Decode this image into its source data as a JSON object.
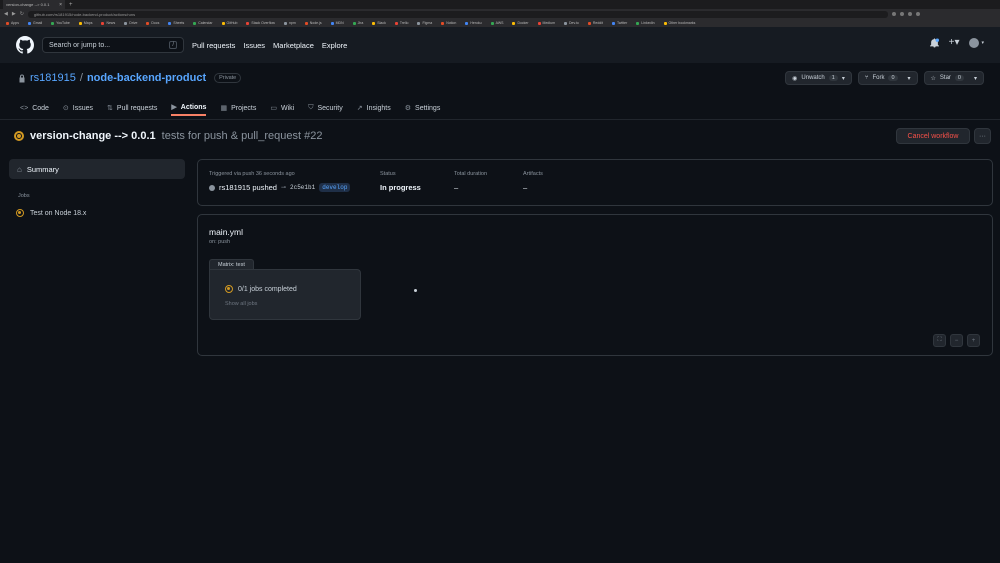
{
  "browser": {
    "tab_title": "version-change --> 0.0.1",
    "new_tab": "+",
    "url": "github.com/rs181915/node-backend-product/actions/runs",
    "bookmarks": [
      "Apps",
      "Gmail",
      "YouTube",
      "Maps",
      "News",
      "Drive",
      "Docs",
      "Sheets",
      "Calendar",
      "GitHub",
      "Stack Overflow",
      "npm",
      "Node.js",
      "MDN",
      "Jira",
      "Slack",
      "Trello",
      "Figma",
      "Notion",
      "Heroku",
      "AWS",
      "Docker",
      "Medium",
      "Dev.to",
      "Reddit",
      "Twitter",
      "LinkedIn",
      "Other bookmarks"
    ]
  },
  "header": {
    "search_placeholder": "Search or jump to...",
    "search_shortcut": "/",
    "nav": [
      "Pull requests",
      "Issues",
      "Marketplace",
      "Explore"
    ]
  },
  "repo": {
    "owner": "rs181915",
    "separator": "/",
    "name": "node-backend-product",
    "visibility": "Private",
    "unwatch_label": "Unwatch",
    "unwatch_count": "1",
    "fork_label": "Fork",
    "fork_count": "0",
    "star_label": "Star",
    "star_count": "0"
  },
  "tabs": [
    {
      "label": "Code",
      "icon": "code-icon"
    },
    {
      "label": "Issues",
      "icon": "issue-icon"
    },
    {
      "label": "Pull requests",
      "icon": "pull-request-icon"
    },
    {
      "label": "Actions",
      "icon": "play-icon"
    },
    {
      "label": "Projects",
      "icon": "project-icon"
    },
    {
      "label": "Wiki",
      "icon": "book-icon"
    },
    {
      "label": "Security",
      "icon": "shield-icon"
    },
    {
      "label": "Insights",
      "icon": "graph-icon"
    },
    {
      "label": "Settings",
      "icon": "gear-icon"
    }
  ],
  "run": {
    "title": "version-change --> 0.0.1",
    "subtitle": "tests for push & pull_request #22",
    "cancel_label": "Cancel workflow",
    "more_label": "···"
  },
  "sidebar": {
    "summary_label": "Summary",
    "jobs_label": "Jobs",
    "jobs": [
      "Test on Node 18.x"
    ]
  },
  "info": {
    "trigger_label": "Triggered via push 36 seconds ago",
    "pusher": "rs181915 pushed",
    "sha": "2c5e1b1",
    "branch": "develop",
    "status_label": "Status",
    "status_value": "In progress",
    "duration_label": "Total duration",
    "duration_value": "–",
    "artifacts_label": "Artifacts",
    "artifacts_value": "–"
  },
  "graph": {
    "workflow_file": "main.yml",
    "trigger": "on: push",
    "matrix_label": "Matrix: test",
    "jobs_completed": "0/1 jobs completed",
    "show_all": "Show all jobs",
    "zoom_fit": "⛶",
    "zoom_out": "−",
    "zoom_in": "+"
  },
  "colors": {
    "accent_link": "#58a6ff",
    "in_progress": "#d29922",
    "danger": "#f85149",
    "active_tab": "#f78166"
  }
}
